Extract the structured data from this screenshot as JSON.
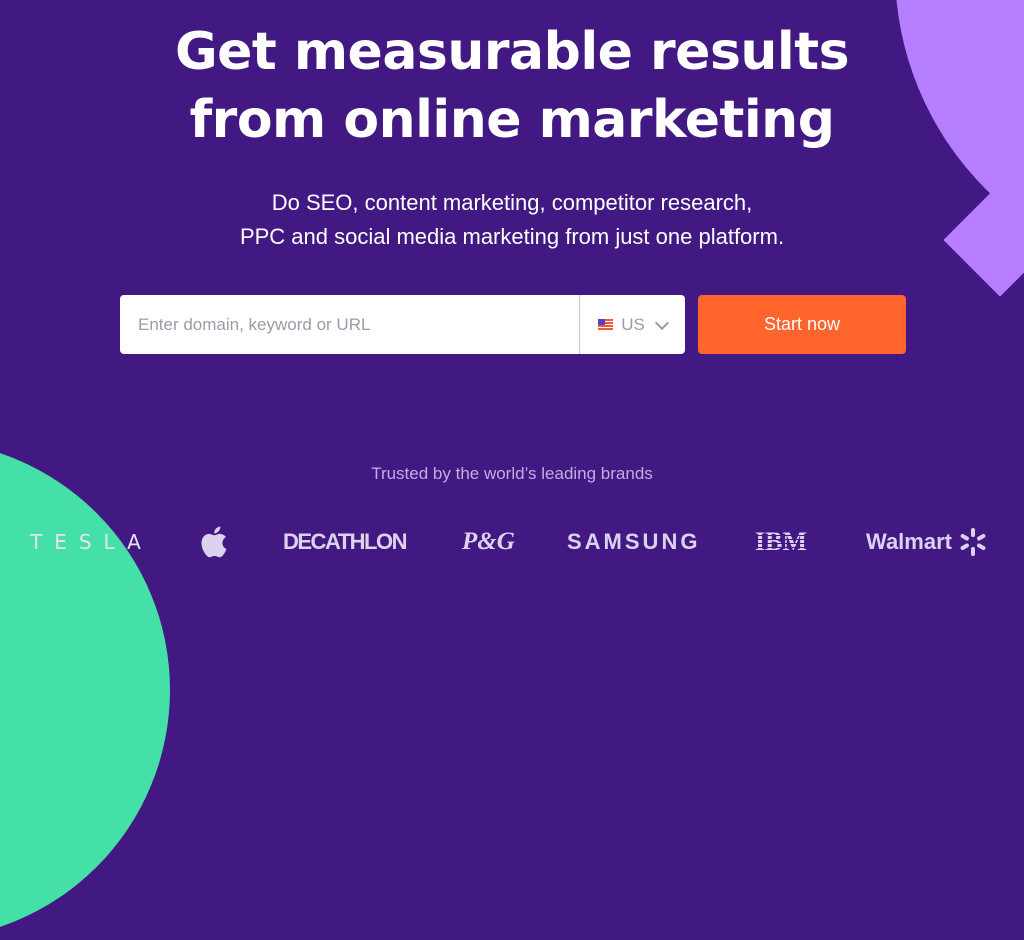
{
  "hero": {
    "headline_line1": "Get measurable results",
    "headline_line2": "from online marketing",
    "subtext_line1": "Do SEO, content marketing, competitor research,",
    "subtext_line2": "PPC and social media marketing from just one platform."
  },
  "search": {
    "placeholder": "Enter domain, keyword or URL",
    "value": "",
    "country": {
      "selected": "US",
      "flag_icon": "us-flag-icon",
      "dropdown_icon": "chevron-down-icon"
    },
    "submit_label": "Start now"
  },
  "trusted": {
    "label": "Trusted by the world’s leading brands",
    "brands": [
      {
        "name": "Tesla",
        "text": "TESLA"
      },
      {
        "name": "Apple",
        "text": ""
      },
      {
        "name": "Decathlon",
        "text": "DECATHLON"
      },
      {
        "name": "P&G",
        "text": "P&G"
      },
      {
        "name": "Samsung",
        "text": "SAMSUNG"
      },
      {
        "name": "IBM",
        "text": "IBM"
      },
      {
        "name": "Walmart",
        "text": "Walmart"
      }
    ]
  },
  "colors": {
    "background": "#421983",
    "accent_button": "#ff642d",
    "decor_purple": "#b57efe",
    "decor_green": "#45e0a8"
  }
}
